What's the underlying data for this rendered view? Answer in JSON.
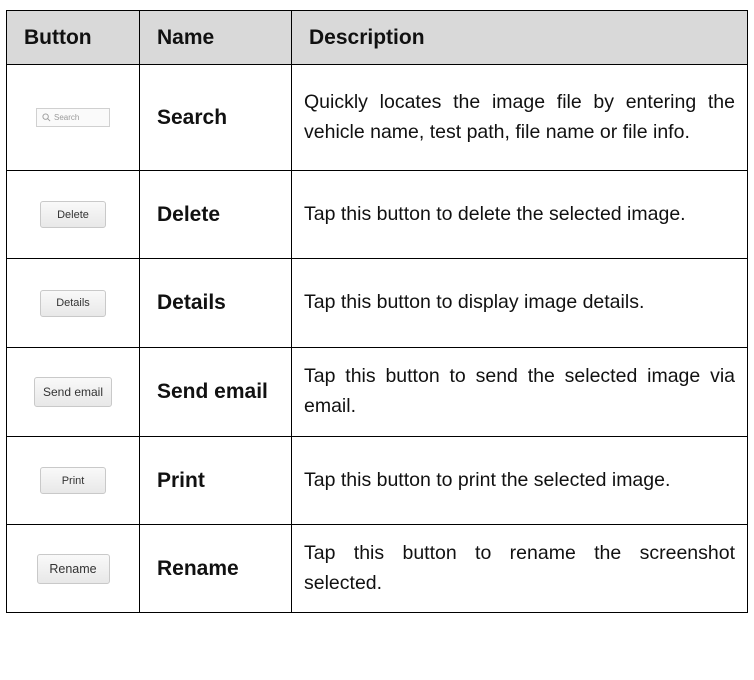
{
  "table": {
    "headers": {
      "button": "Button",
      "name": "Name",
      "description": "Description"
    },
    "rows": [
      {
        "button_label": "Search",
        "button_style": "search-field",
        "icon": "search-icon",
        "name": "Search",
        "description": "Quickly locates the image file by entering the vehicle name, test path, file name or file info."
      },
      {
        "button_label": "Delete",
        "name": "Delete",
        "description": "Tap this button to delete the selected image."
      },
      {
        "button_label": "Details",
        "name": "Details",
        "description": "Tap this button to display image details."
      },
      {
        "button_label": "Send email",
        "name": "Send email",
        "description": "Tap this button to send the selected image via email."
      },
      {
        "button_label": "Print",
        "name": "Print",
        "description": "Tap this button to print the selected image."
      },
      {
        "button_label": "Rename",
        "name": "Rename",
        "description": "Tap this button to rename the screenshot selected."
      }
    ]
  },
  "colors": {
    "header_background": "#d9d9d9",
    "border": "#000000"
  }
}
